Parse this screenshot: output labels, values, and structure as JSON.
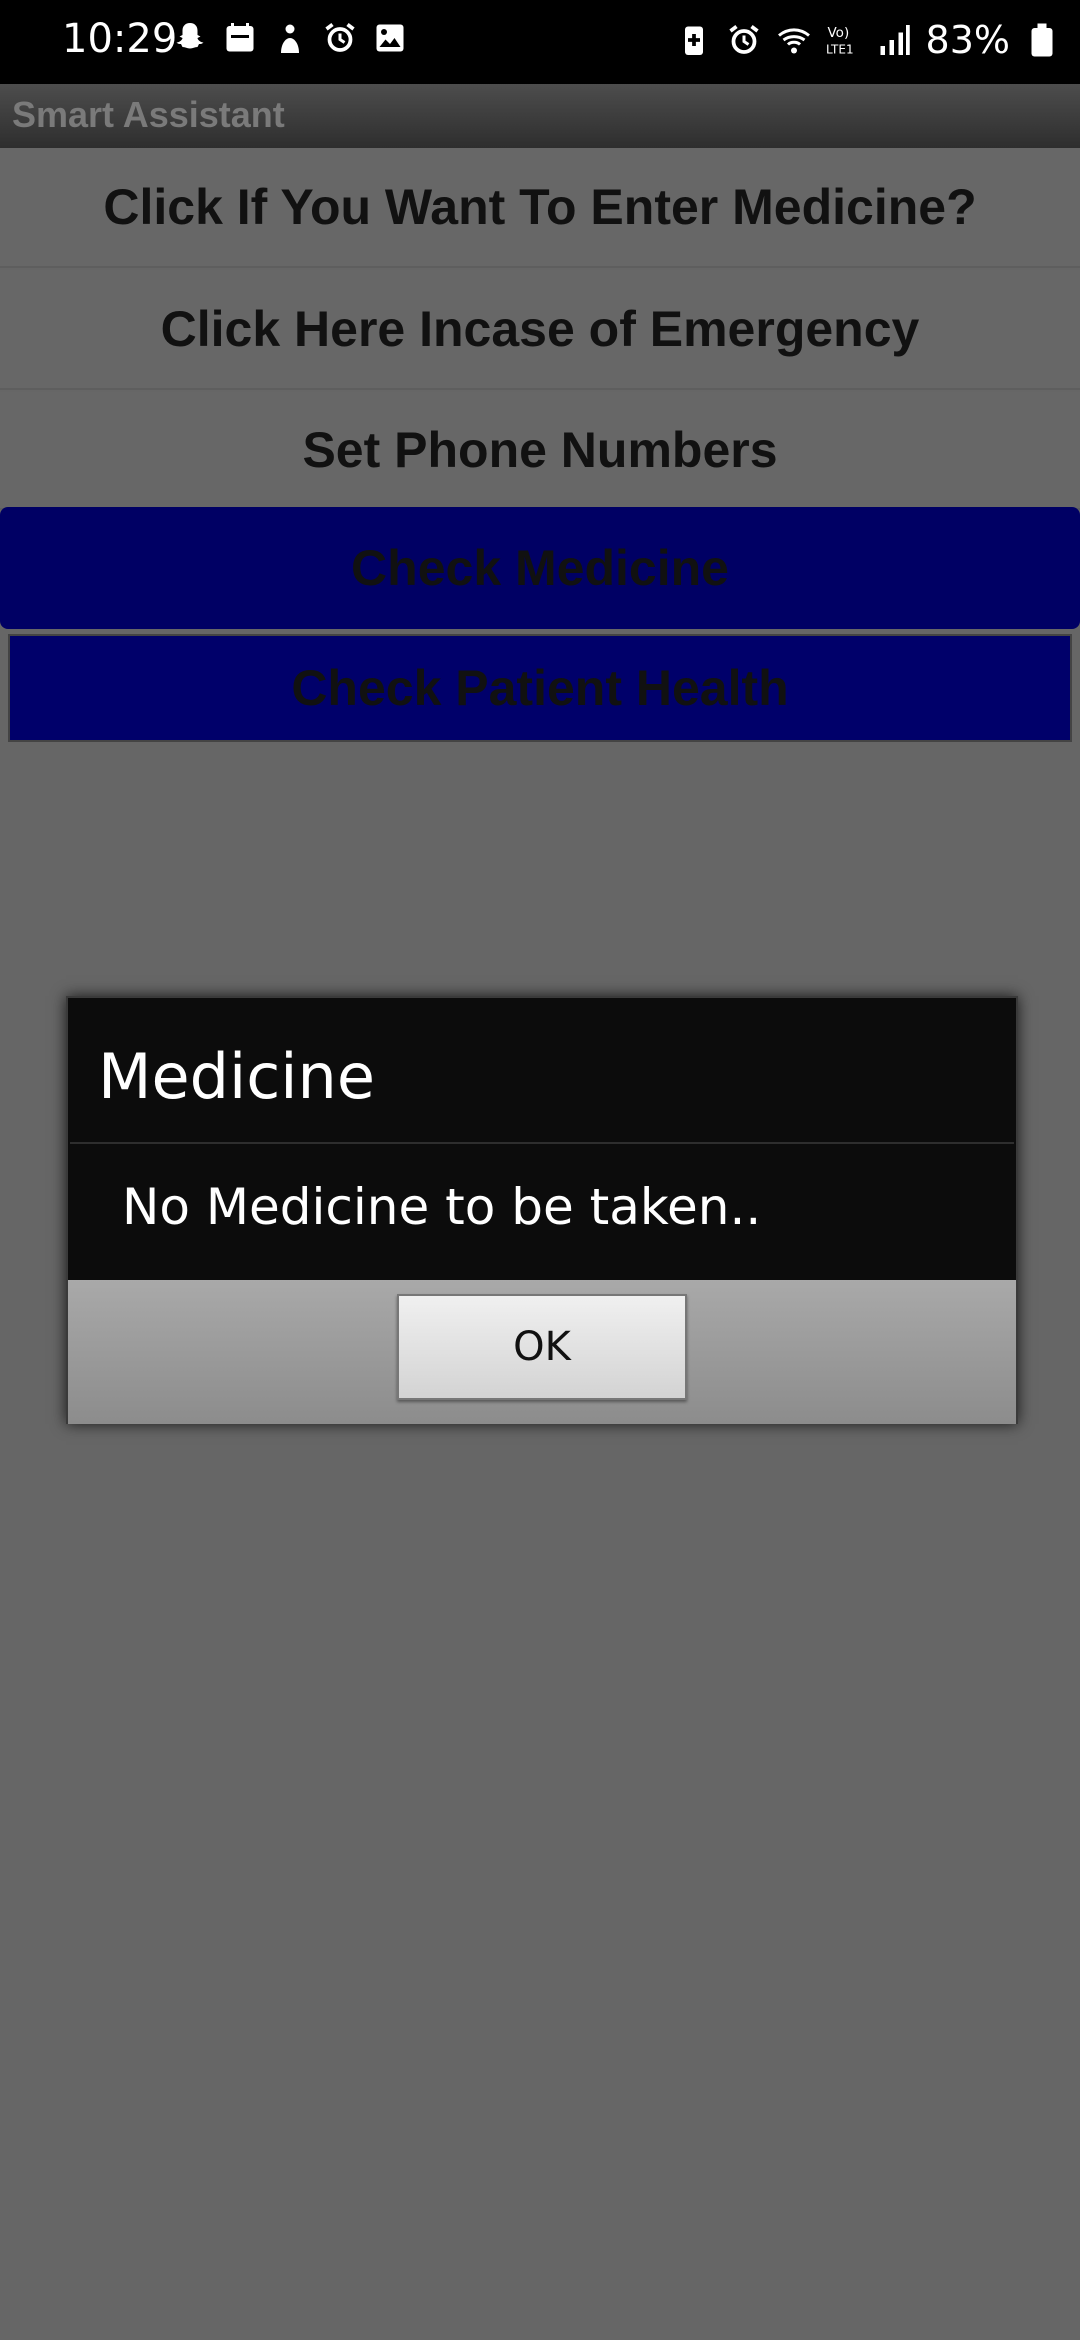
{
  "status_bar": {
    "time": "10:29",
    "battery": "83%",
    "left_icons": [
      "snapchat-icon",
      "calendar-icon",
      "person-icon",
      "alarm-icon",
      "gallery-icon"
    ],
    "right_icons": [
      "battery-saver-icon",
      "alarm-icon",
      "wifi-icon",
      "volte-icon",
      "signal-icon",
      "battery-icon"
    ]
  },
  "app": {
    "title": "Smart Assistant"
  },
  "buttons": {
    "enter_medicine": "Click If You Want To Enter Medicine?",
    "emergency": "Click Here Incase of Emergency",
    "set_phone_numbers": "Set Phone Numbers",
    "check_medicine": "Check Medicine",
    "check_patient_health": "Check Patient Health"
  },
  "dialog": {
    "title": "Medicine",
    "message": "No Medicine to be taken..",
    "ok_label": "OK"
  },
  "colors": {
    "screen_bg": "#666666",
    "blue_button": "#000064",
    "dialog_bg": "#0c0c0c"
  }
}
